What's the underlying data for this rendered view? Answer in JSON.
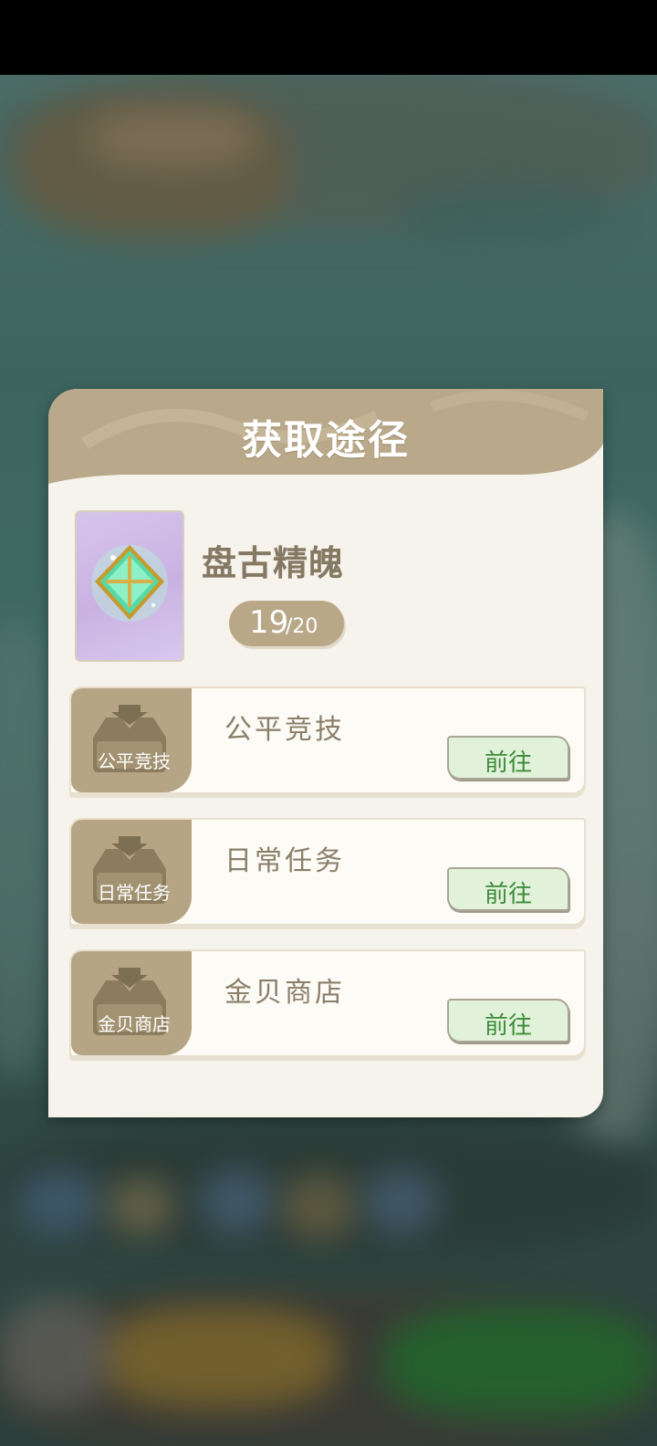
{
  "dialog": {
    "title": "获取途径",
    "item": {
      "name": "盘古精魄",
      "count_current": "19",
      "count_max": "/20",
      "icon": "crystal-gem-icon"
    },
    "routes": [
      {
        "icon": "download-tray-icon",
        "icon_label": "公平竞技",
        "title": "公平竞技",
        "button": "前往"
      },
      {
        "icon": "download-tray-icon",
        "icon_label": "日常任务",
        "title": "日常任务",
        "button": "前往"
      },
      {
        "icon": "download-tray-icon",
        "icon_label": "金贝商店",
        "title": "金贝商店",
        "button": "前往"
      }
    ]
  },
  "colors": {
    "header": "#b9a98a",
    "panel": "#f6f3ec",
    "button_bg": "#e2f2da",
    "button_text": "#3c8c3a"
  }
}
